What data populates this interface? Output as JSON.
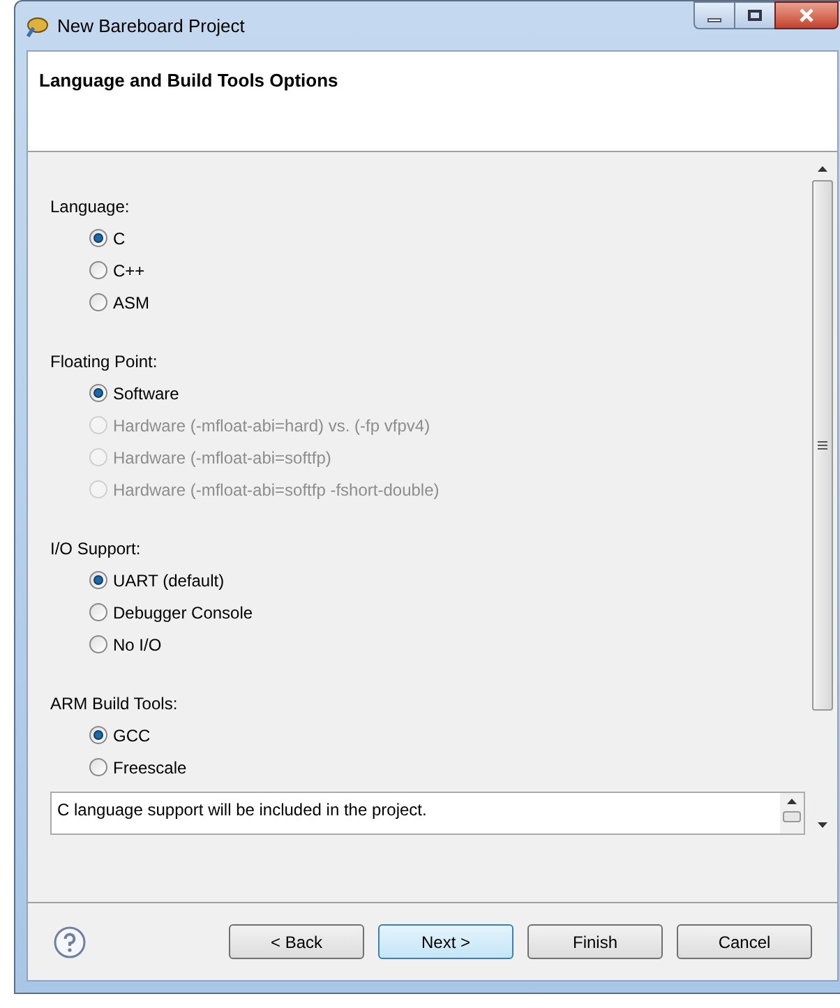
{
  "window": {
    "title": "New Bareboard Project"
  },
  "header": {
    "title": "Language and Build Tools Options"
  },
  "groups": [
    {
      "label": "Language:",
      "options": [
        {
          "label": "C",
          "selected": true,
          "disabled": false
        },
        {
          "label": "C++",
          "selected": false,
          "disabled": false
        },
        {
          "label": "ASM",
          "selected": false,
          "disabled": false
        }
      ]
    },
    {
      "label": "Floating Point:",
      "options": [
        {
          "label": "Software",
          "selected": true,
          "disabled": false
        },
        {
          "label": "Hardware (-mfloat-abi=hard) vs. (-fp vfpv4)",
          "selected": false,
          "disabled": true
        },
        {
          "label": "Hardware (-mfloat-abi=softfp)",
          "selected": false,
          "disabled": true
        },
        {
          "label": "Hardware (-mfloat-abi=softfp -fshort-double)",
          "selected": false,
          "disabled": true
        }
      ]
    },
    {
      "label": "I/O Support:",
      "options": [
        {
          "label": "UART (default)",
          "selected": true,
          "disabled": false
        },
        {
          "label": "Debugger Console",
          "selected": false,
          "disabled": false
        },
        {
          "label": "No I/O",
          "selected": false,
          "disabled": false
        }
      ]
    },
    {
      "label": "ARM Build Tools:",
      "options": [
        {
          "label": "GCC",
          "selected": true,
          "disabled": false
        },
        {
          "label": "Freescale",
          "selected": false,
          "disabled": false
        }
      ]
    }
  ],
  "description": "C language support will be included in the project.",
  "buttons": [
    {
      "label": "< Back",
      "default": false
    },
    {
      "label": "Next >",
      "default": true
    },
    {
      "label": "Finish",
      "default": false
    },
    {
      "label": "Cancel",
      "default": false
    }
  ]
}
